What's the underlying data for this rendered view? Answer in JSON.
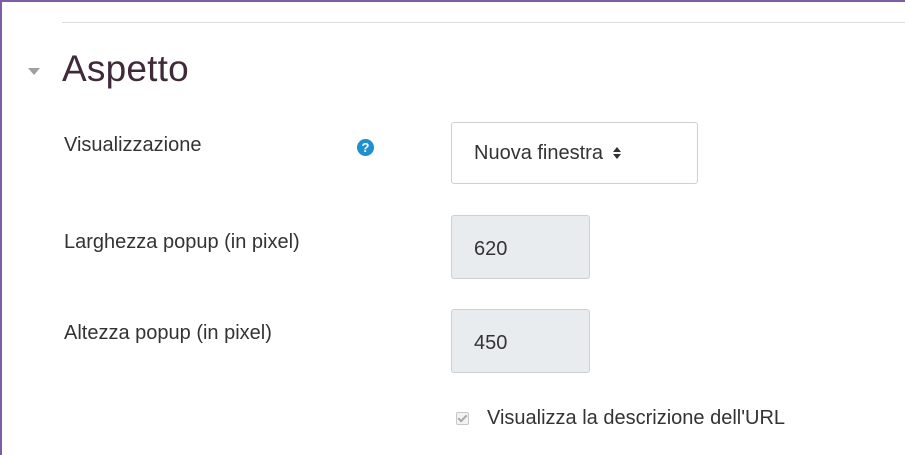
{
  "section": {
    "title": "Aspetto",
    "collapse_icon": "caret-down-icon"
  },
  "display": {
    "label": "Visualizzazione",
    "help_icon": "question-circle-icon",
    "help_glyph": "?",
    "selected_value": "Nuova finestra",
    "select_icon": "select-arrows-icon"
  },
  "popup_width": {
    "label": "Larghezza popup (in pixel)",
    "value": "620"
  },
  "popup_height": {
    "label": "Altezza popup (in pixel)",
    "value": "450"
  },
  "show_description": {
    "label": "Visualizza la descrizione dell'URL",
    "checked": true,
    "disabled": true
  },
  "colors": {
    "frame_border": "#7b5ea6",
    "title": "#3f2a3a",
    "help_icon": "#1f8fd1",
    "readonly_input_bg": "#e9ecef"
  }
}
